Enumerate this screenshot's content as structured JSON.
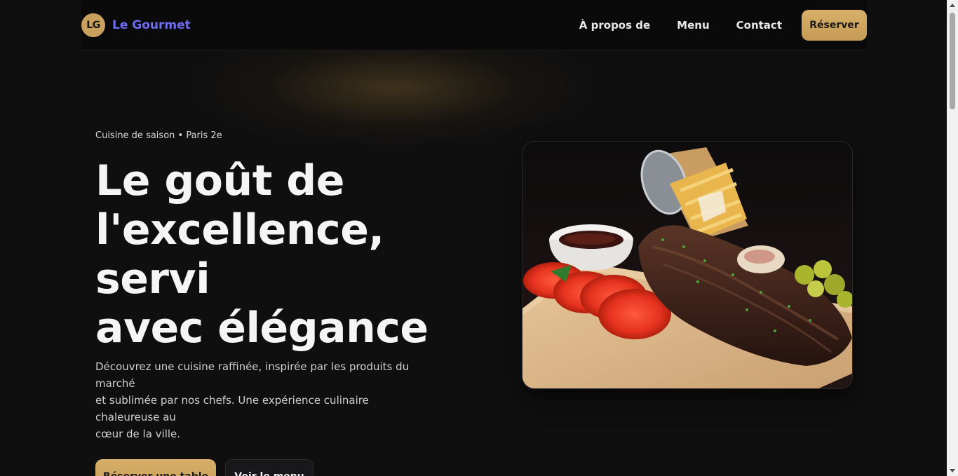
{
  "brand": {
    "logo_initials": "LG",
    "name": "Le Gourmet",
    "accent_color": "#c9a15d",
    "name_color": "#6e6cf0"
  },
  "nav": {
    "links": [
      "À propos de",
      "Menu",
      "Contact"
    ],
    "cta_label": "Réserver"
  },
  "hero": {
    "eyebrow": "Cuisine de saison • Paris 2e",
    "headline_line1": "Le goût de",
    "headline_line2": "l'excellence, servi",
    "headline_line3": "avec élégance",
    "lede_line1": "Découvrez une cuisine raffinée, inspirée par les produits du marché",
    "lede_line2": "et sublimée par nos chefs. Une expérience culinaire chaleureuse au",
    "lede_line3": "cœur de la ville.",
    "primary_cta": "Réserver une table",
    "secondary_cta": "Voir le menu",
    "image_subject": "ribs-platter-photo"
  }
}
